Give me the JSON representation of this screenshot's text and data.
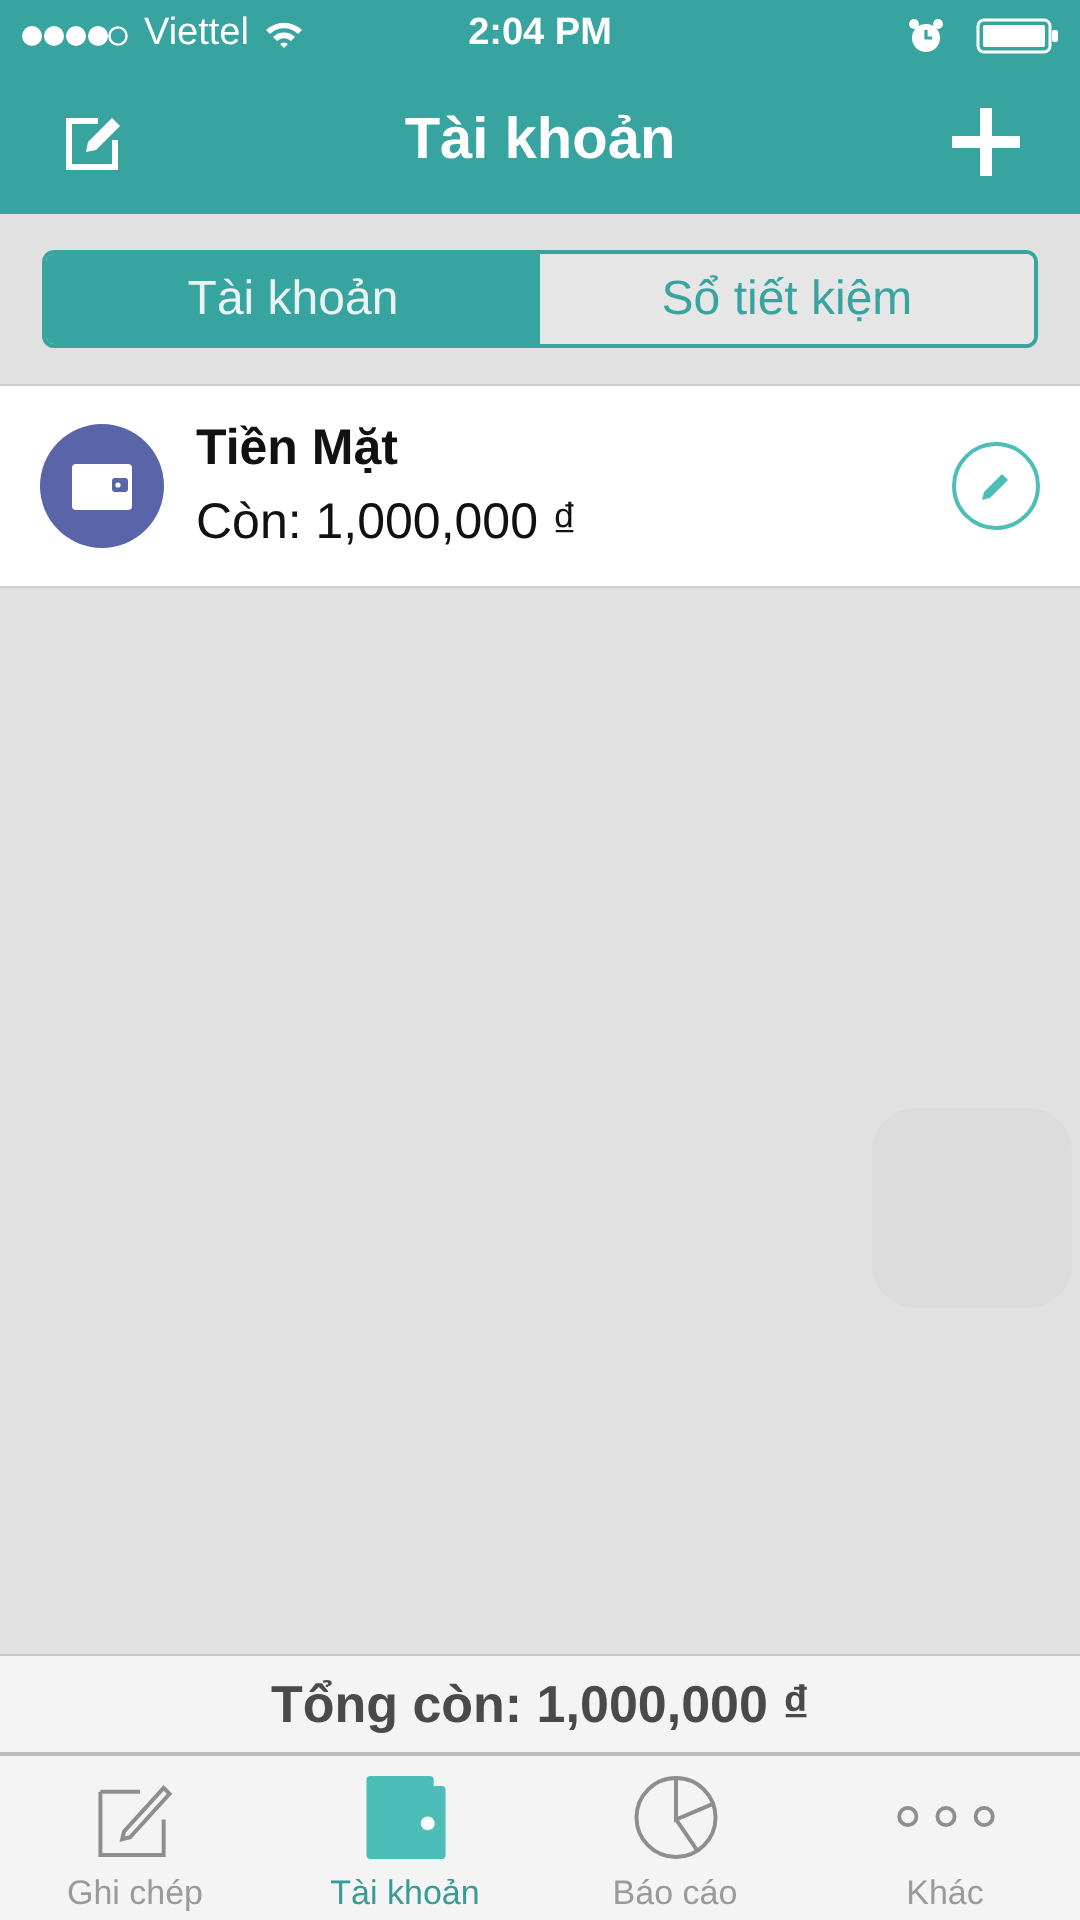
{
  "status_bar": {
    "carrier": "Viettel",
    "time": "2:04 PM"
  },
  "header": {
    "title": "Tài khoản"
  },
  "segments": [
    {
      "label": "Tài khoản",
      "selected": true
    },
    {
      "label": "Sổ tiết kiệm",
      "selected": false
    }
  ],
  "accounts": [
    {
      "name": "Tiền Mặt",
      "balance": "Còn: 1,000,000 ₫"
    }
  ],
  "total": "Tổng còn: 1,000,000 ₫",
  "tab_bar": [
    {
      "label": "Ghi chép",
      "selected": false
    },
    {
      "label": "Tài khoản",
      "selected": true
    },
    {
      "label": "Báo cáo",
      "selected": false
    },
    {
      "label": "Khác",
      "selected": false
    }
  ]
}
